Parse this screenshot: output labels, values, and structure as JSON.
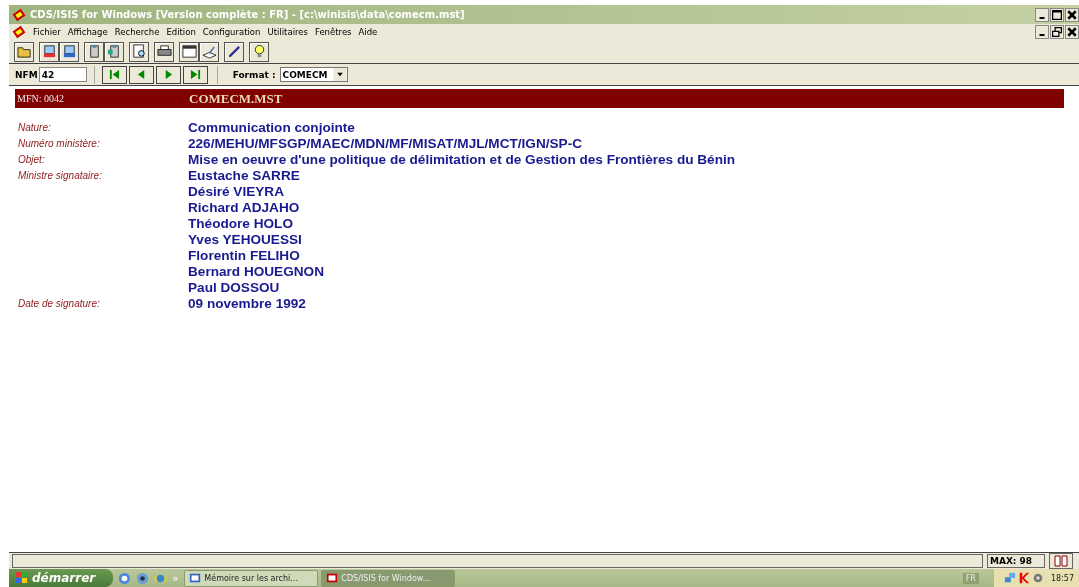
{
  "window": {
    "title": "CDS/ISIS for Windows [Version complète : FR] - [c:\\winisis\\data\\comecm.mst]"
  },
  "menu": [
    "Fichier",
    "Affichage",
    "Recherche",
    "Edition",
    "Configuration",
    "Utilitaires",
    "Fenêtres",
    "Aide"
  ],
  "toolbar": [
    {
      "kind": "folder"
    },
    {
      "kind": "txt"
    },
    {
      "kind": "rtf"
    },
    {
      "kind": "clip"
    },
    {
      "kind": "clip2"
    },
    {
      "kind": "preview"
    },
    {
      "kind": "print"
    },
    {
      "kind": "window"
    },
    {
      "kind": "hand"
    },
    {
      "kind": "pencil"
    },
    {
      "kind": "bulb"
    }
  ],
  "nav": {
    "label": "NFM",
    "value": "42",
    "format_label": "Format :",
    "format_value": "COMECM"
  },
  "record": {
    "mfn": "MFN: 0042",
    "title": "COMECM.MST",
    "fields": [
      {
        "label": "Nature:",
        "values": [
          "Communication conjointe"
        ]
      },
      {
        "label": "Numéro ministère:",
        "values": [
          "226/MEHU/MFSGP/MAEC/MDN/MF/MISAT/MJL/MCT/IGN/SP-C"
        ]
      },
      {
        "label": "Objet:",
        "values": [
          "Mise en oeuvre d'une politique de délimitation et de Gestion des Frontières du Bénin"
        ]
      },
      {
        "label": "Ministre signataire:",
        "values": [
          "Eustache SARRE",
          "Désiré VIEYRA",
          "Richard ADJAHO",
          "Théodore HOLO",
          "Yves YEHOUESSI",
          "Florentin FELIHO",
          "Bernard HOUEGNON",
          "Paul DOSSOU"
        ]
      },
      {
        "label": "Date de signature:",
        "values": [
          "09 novembre 1992"
        ]
      }
    ]
  },
  "status_bar": {
    "max": "MAX: 98"
  },
  "taskbar": {
    "start": "démarrer",
    "more": "»",
    "tasks": [
      {
        "label": "Mémoire sur les archi...",
        "selected": false
      },
      {
        "label": "CDS/ISIS for Window...",
        "selected": true
      }
    ],
    "lang": "FR",
    "time": "18:57"
  }
}
